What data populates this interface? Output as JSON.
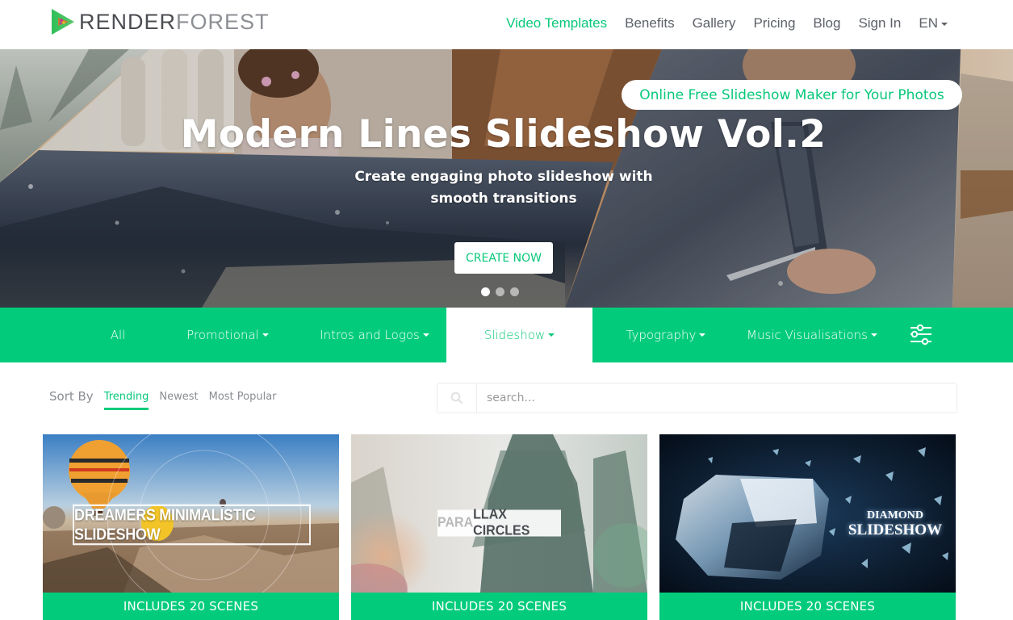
{
  "brand": {
    "name_part1": "RENDER",
    "name_part2": "FOREST",
    "accent_color": "#02cc7c",
    "text_color": "#5c6068"
  },
  "nav": {
    "items": [
      {
        "label": "Video Templates",
        "active": true
      },
      {
        "label": "Benefits"
      },
      {
        "label": "Gallery"
      },
      {
        "label": "Pricing"
      },
      {
        "label": "Blog"
      },
      {
        "label": "Sign In"
      },
      {
        "label": "EN",
        "has_dropdown": true
      }
    ]
  },
  "hero": {
    "pill_label": "Online Free Slideshow Maker for Your Photos",
    "title": "Modern Lines Slideshow Vol.2",
    "subtitle": "Create engaging photo slideshow with smooth transitions",
    "cta_label": "CREATE NOW",
    "slides_total": 3,
    "slide_active": 1
  },
  "categories": {
    "items": [
      {
        "label": "All",
        "has_dropdown": false
      },
      {
        "label": "Promotional",
        "has_dropdown": true
      },
      {
        "label": "Intros and Logos",
        "has_dropdown": true
      },
      {
        "label": "Slideshow",
        "has_dropdown": true,
        "active": true
      },
      {
        "label": "Typography",
        "has_dropdown": true
      },
      {
        "label": "Music Visualisations",
        "has_dropdown": true
      }
    ],
    "filter_icon": "sliders-icon"
  },
  "sort": {
    "label": "Sort By",
    "options": [
      {
        "label": "Trending",
        "active": true
      },
      {
        "label": "Newest"
      },
      {
        "label": "Most Popular"
      }
    ]
  },
  "search": {
    "placeholder": "search...",
    "value": "",
    "icon": "search-icon"
  },
  "cards": [
    {
      "thumb_title": "DREAMERS MINIMALISTIC SLIDESHOW",
      "footer": "INCLUDES 20 SCENES"
    },
    {
      "thumb_title_a": "PARA",
      "thumb_title_b": "LLAX CIRCLES",
      "footer": "INCLUDES 20 SCENES"
    },
    {
      "thumb_title_line1": "DIAMOND",
      "thumb_title_line2": "SLIDESHOW",
      "footer": "INCLUDES 20 SCENES"
    }
  ]
}
